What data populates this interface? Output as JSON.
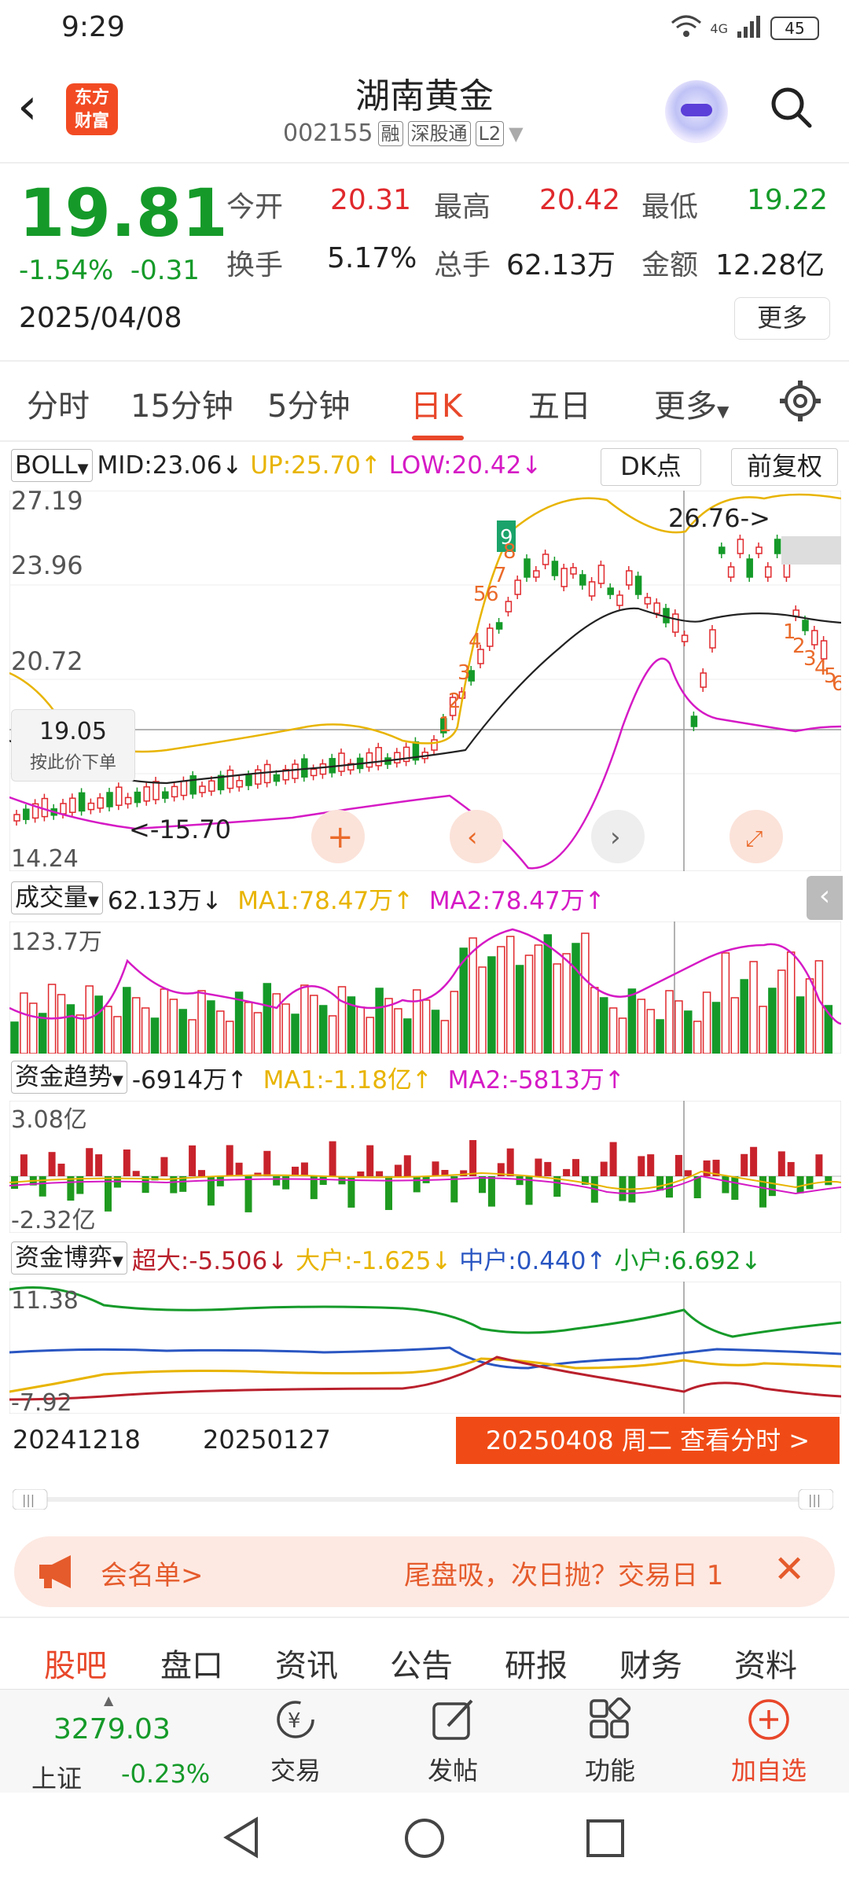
{
  "status": {
    "time": "9:29",
    "battery": "45",
    "net": "4G"
  },
  "header": {
    "logo": [
      "东方",
      "财富"
    ],
    "title": "湖南黄金",
    "code": "002155",
    "tags": [
      "融",
      "深股通",
      "L2"
    ]
  },
  "quote": {
    "price": "19.81",
    "change_pct": "-1.54%",
    "change_abs": "-0.31",
    "date": "2025/04/08",
    "open_label": "今开",
    "open": "20.31",
    "high_label": "最高",
    "high": "20.42",
    "low_label": "最低",
    "low": "19.22",
    "turnover_label": "换手",
    "turnover": "5.17%",
    "volume_label": "总手",
    "volume": "62.13万",
    "amount_label": "金额",
    "amount": "12.28亿",
    "more": "更多"
  },
  "tabs": [
    "分时",
    "15分钟",
    "5分钟",
    "日K",
    "五日",
    "更多"
  ],
  "active_tab": "日K",
  "boll": {
    "name": "BOLL",
    "mid": "MID:23.06↓",
    "up": "UP:25.70↑",
    "low": "LOW:20.42↓",
    "dk": "DK点",
    "fq": "前复权",
    "axis_top": "27.19",
    "axis_mid1": "23.96",
    "axis_mid2": "20.72",
    "axis_bottom": "14.24",
    "high_mark": "26.76->",
    "low_mark": "<-15.70",
    "price_tag": "19.05",
    "price_tag_sub": "按此价下单"
  },
  "volume": {
    "name": "成交量",
    "value": "62.13万↓",
    "ma1": "MA1:78.47万↑",
    "ma2": "MA2:78.47万↑",
    "axis_top": "123.7万"
  },
  "fund_trend": {
    "name": "资金趋势",
    "value": "-6914万↑",
    "ma1": "MA1:-1.18亿↑",
    "ma2": "MA2:-5813万↑",
    "axis_top": "3.08亿",
    "axis_bottom": "-2.32亿"
  },
  "fund_game": {
    "name": "资金博弈",
    "super": "超大:-5.506↓",
    "large": "大户:-1.625↓",
    "mid": "中户:0.440↑",
    "small": "小户:6.692↓",
    "axis_top": "11.38",
    "axis_bottom": "-7.92"
  },
  "date_axis": {
    "d1": "20241218",
    "d2": "20250127",
    "button": "20250408 周二 查看分时 >"
  },
  "banner": {
    "left": "会名单>",
    "right": "尾盘吸，次日抛？交易日 1"
  },
  "bottom_tabs": [
    "股吧",
    "盘口",
    "资讯",
    "公告",
    "研报",
    "财务",
    "资料"
  ],
  "navbar": {
    "index_value": "3279.03",
    "index_name": "上证",
    "index_chg": "-0.23%",
    "trade": "交易",
    "post": "发帖",
    "func": "功能",
    "add": "加自选"
  },
  "colors": {
    "accent": "#e8472a",
    "up": "#e0292d",
    "down": "#159a29",
    "ma_yellow": "#e8b400",
    "ma_magenta": "#d51ac5"
  }
}
